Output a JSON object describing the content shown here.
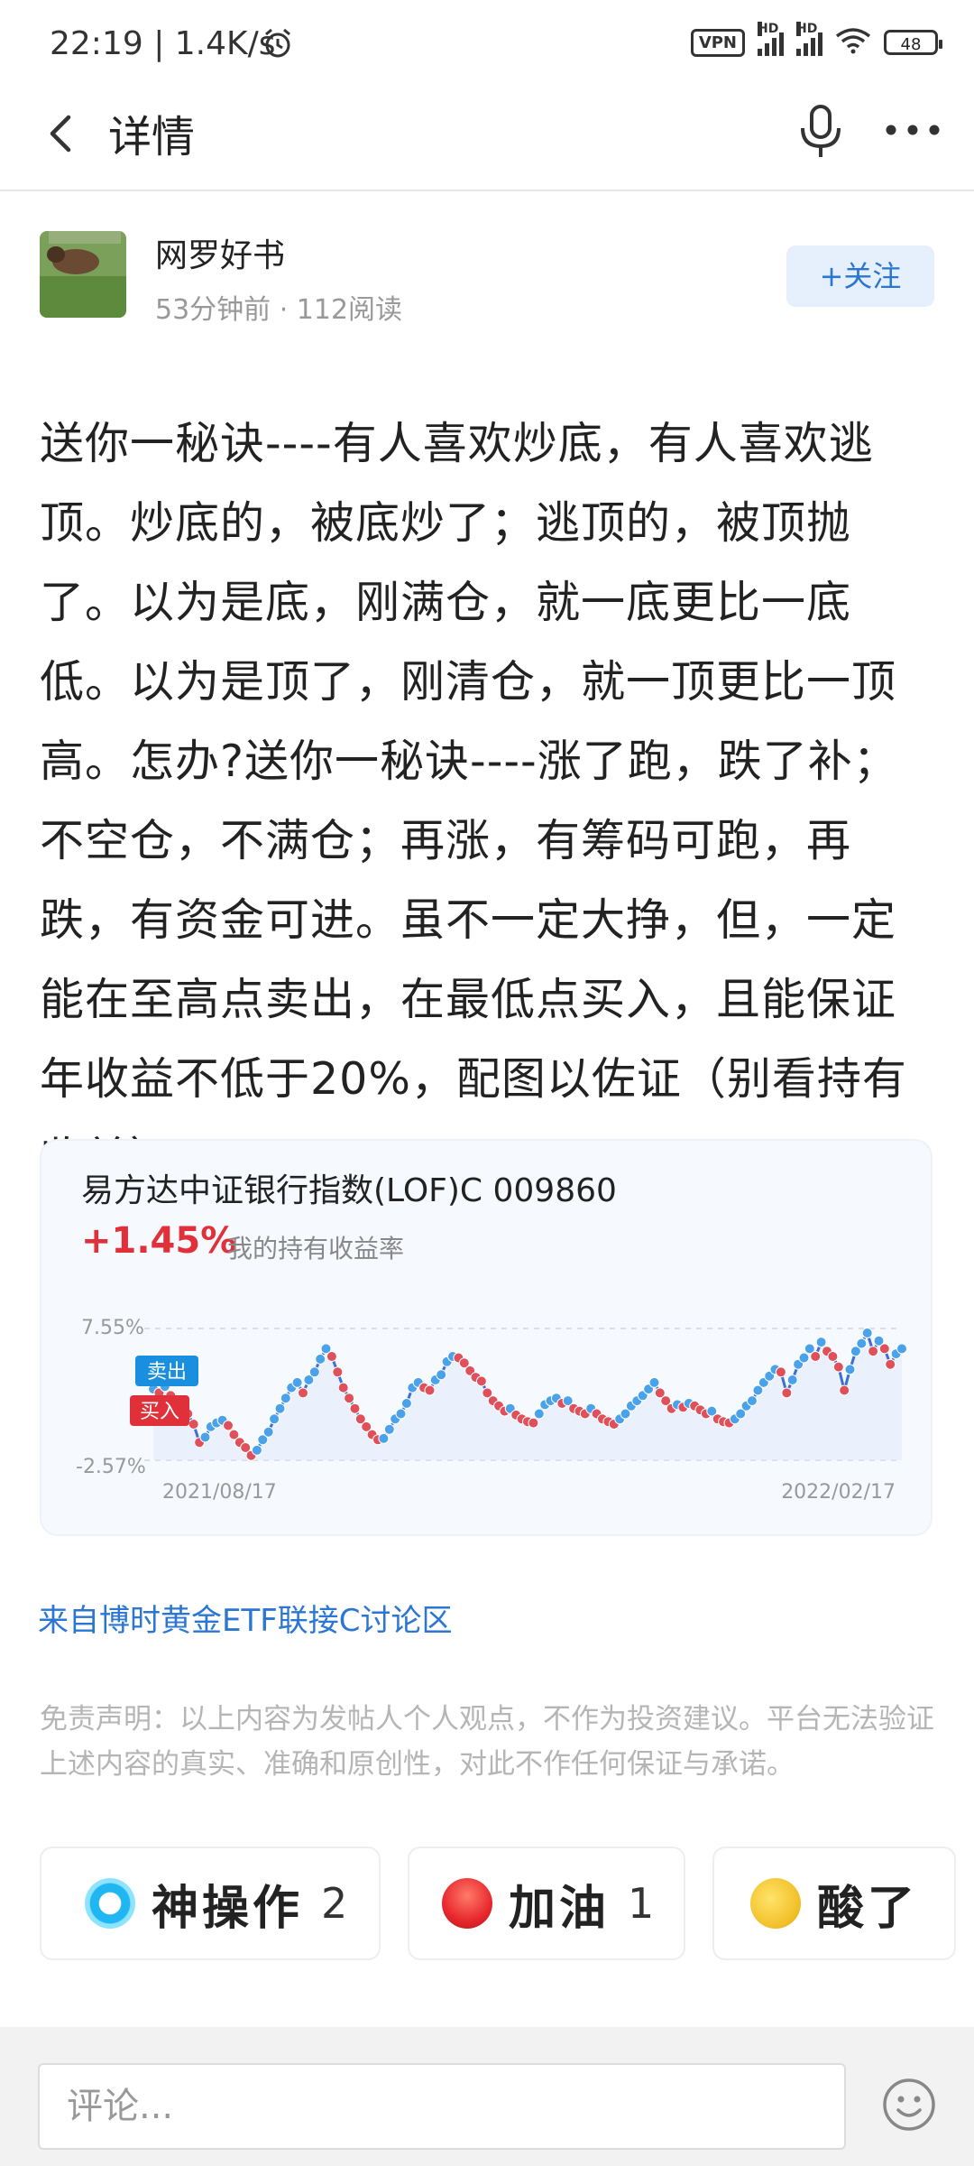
{
  "status_bar": {
    "time": "22:19",
    "speed": "1.4K/s",
    "vpn": "VPN",
    "hd1": "HD",
    "hd2": "HD",
    "battery": "48"
  },
  "nav": {
    "title": "详情"
  },
  "author": {
    "name": "网罗好书",
    "time": "53分钟前",
    "reads": "112阅读",
    "follow_label": "+关注"
  },
  "article": {
    "text": "送你一秘诀----有人喜欢炒底，有人喜欢逃顶。炒底的，被底炒了；逃顶的，被顶抛了。以为是底，刚满仓，就一底更比一底低。以为是顶了，刚清仓，就一顶更比一顶高。怎办?送你一秘诀----涨了跑，跌了补；不空仓，不满仓；再涨，有筹码可跑，再跌，有资金可进。虽不一定大挣，但，一定能在至高点卖出，在最低点买入，且能保证年收益不低于20%，配图以佐证（别看持有收益）。"
  },
  "fund_card": {
    "name": "易方达中证银行指数(LOF)C 009860",
    "rate": "+1.45%",
    "rate_label": "我的持有收益率"
  },
  "chart_data": {
    "type": "line",
    "ymax_label": "7.55%",
    "ymin_label": "-2.57%",
    "ylim": [
      -2.57,
      7.55
    ],
    "x_start_label": "2021/08/17",
    "x_end_label": "2022/02/17",
    "sell_label": "卖出",
    "buy_label": "买入",
    "line_color": "#3b6fd6",
    "sell_color": "#4aa3ea",
    "buy_color": "#e0505a",
    "values": [
      2.9,
      2.6,
      3.1,
      2.4,
      1.9,
      1.4,
      1.0,
      0.2,
      -1.2,
      -0.8,
      0.0,
      0.3,
      0.5,
      0.1,
      -0.6,
      -1.2,
      -1.6,
      -2.2,
      -1.8,
      -1.0,
      -0.4,
      0.6,
      1.4,
      2.2,
      3.0,
      3.4,
      2.6,
      3.6,
      4.2,
      5.2,
      6.0,
      5.4,
      4.2,
      3.0,
      2.2,
      1.4,
      0.6,
      0.0,
      -0.6,
      -1.0,
      -0.9,
      -0.2,
      0.6,
      1.0,
      1.8,
      3.0,
      3.4,
      3.0,
      2.8,
      3.6,
      4.0,
      5.0,
      5.4,
      5.3,
      4.9,
      4.3,
      3.8,
      3.5,
      2.6,
      2.0,
      1.6,
      1.2,
      1.4,
      0.9,
      0.6,
      0.4,
      0.3,
      1.0,
      1.7,
      2.0,
      2.2,
      1.8,
      2.0,
      1.4,
      1.2,
      1.0,
      1.4,
      1.0,
      0.6,
      0.4,
      0.2,
      0.6,
      1.0,
      1.6,
      2.0,
      2.4,
      2.9,
      3.4,
      2.6,
      2.0,
      1.4,
      1.7,
      1.5,
      1.8,
      1.6,
      1.3,
      1.0,
      1.2,
      0.6,
      0.4,
      0.3,
      0.6,
      1.0,
      1.6,
      2.0,
      2.8,
      3.4,
      3.9,
      4.4,
      4.2,
      2.6,
      3.6,
      4.8,
      5.3,
      6.0,
      5.4,
      6.5,
      5.8,
      5.4,
      4.6,
      2.8,
      4.4,
      5.8,
      6.4,
      7.2,
      5.8,
      6.6,
      6.0,
      4.8,
      5.6,
      6.0
    ]
  },
  "link_text": "来自博时黄金ETF联接C讨论区",
  "disclaimer": "免责声明：以上内容为发帖人个人观点，不作为投资建议。平台无法验证上述内容的真实、准确和原创性，对此不作任何保证与承诺。",
  "reactions": [
    {
      "label": "神操作",
      "count": "2"
    },
    {
      "label": "加油",
      "count": "1"
    },
    {
      "label": "酸了",
      "count": ""
    }
  ],
  "comment": {
    "placeholder": "评论..."
  }
}
